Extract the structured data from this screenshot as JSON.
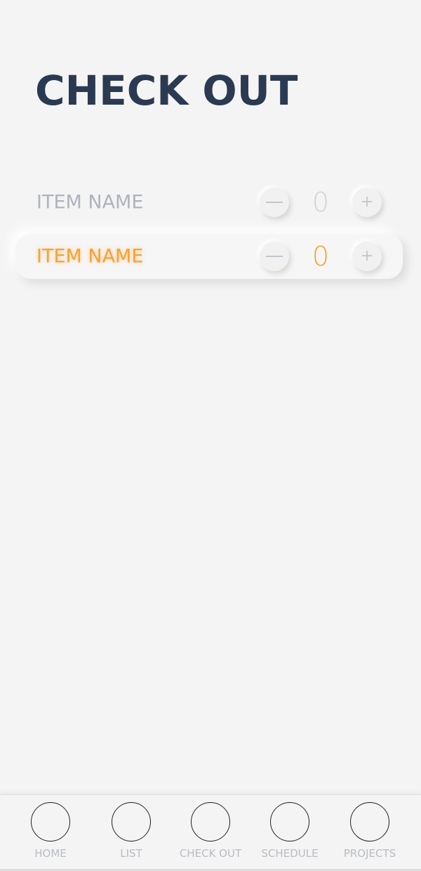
{
  "page": {
    "title": "CHECK OUT"
  },
  "items": [
    {
      "name": "ITEM NAME",
      "quantity": "0",
      "minus_label": "—",
      "plus_label": "+",
      "state": "default"
    },
    {
      "name": "ITEM NAME",
      "quantity": "0",
      "minus_label": "—",
      "plus_label": "+",
      "state": "selected"
    }
  ],
  "nav": [
    {
      "label": "HOME"
    },
    {
      "label": "LIST"
    },
    {
      "label": "CHECK OUT"
    },
    {
      "label": "SCHEDULE"
    },
    {
      "label": "PROJECTS"
    }
  ],
  "colors": {
    "title": "#2a3a52",
    "accent": "#f7a233",
    "muted_text": "#aeb3bd",
    "background": "#f4f4f4"
  }
}
